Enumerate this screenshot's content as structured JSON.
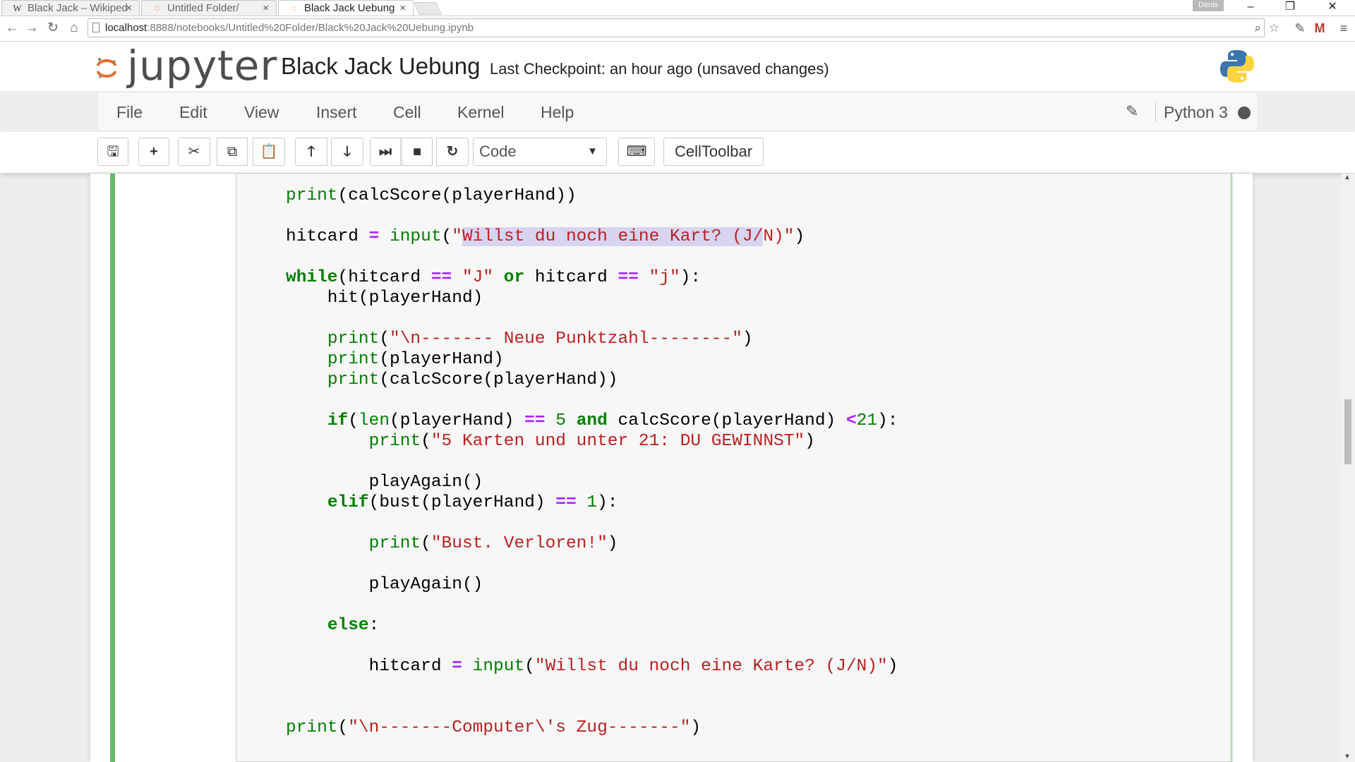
{
  "browser": {
    "tabs": [
      {
        "label": "Black Jack – Wikiped",
        "favicon": "W",
        "active": false
      },
      {
        "label": "Untitled Folder/",
        "favicon": "jupyter-icon",
        "active": false
      },
      {
        "label": "Black Jack Uebung",
        "favicon": "jupyter-icon",
        "active": true
      }
    ],
    "profile_label": "Denis",
    "url_host": "localhost",
    "url_rest": ":8888/notebooks/Untitled%20Folder/Black%20Jack%20Uebung.ipynb"
  },
  "header": {
    "logo_text": "jupyter",
    "notebook_name": "Black Jack Uebung",
    "checkpoint": "Last Checkpoint: an hour ago (unsaved changes)"
  },
  "menu": {
    "items": [
      "File",
      "Edit",
      "View",
      "Insert",
      "Cell",
      "Kernel",
      "Help"
    ],
    "kernel": "Python 3"
  },
  "toolbar": {
    "cell_type": "Code",
    "celltoolbar_label": "CellToolbar"
  },
  "cell": {
    "lines": [
      "print(calcScore(playerHand))",
      "",
      "hitcard = input(\"Willst du noch eine Kart? (J/N)\")",
      "",
      "while(hitcard == \"J\" or hitcard == \"j\"):",
      "    hit(playerHand)",
      "",
      "    print(\"\\n------- Neue Punktzahl--------\")",
      "    print(playerHand)",
      "    print(calcScore(playerHand))",
      "",
      "    if(len(playerHand) == 5 and calcScore(playerHand) <21):",
      "        print(\"5 Karten und unter 21: DU GEWINNST\")",
      "",
      "        playAgain()",
      "    elif(bust(playerHand) == 1):",
      "",
      "        print(\"Bust. Verloren!\")",
      "",
      "        playAgain()",
      "",
      "    else:",
      "",
      "        hitcard = input(\"Willst du noch eine Karte? (J/N)\")",
      "",
      "",
      "print(\"\\n-------Computer\\'s Zug-------\")"
    ]
  }
}
